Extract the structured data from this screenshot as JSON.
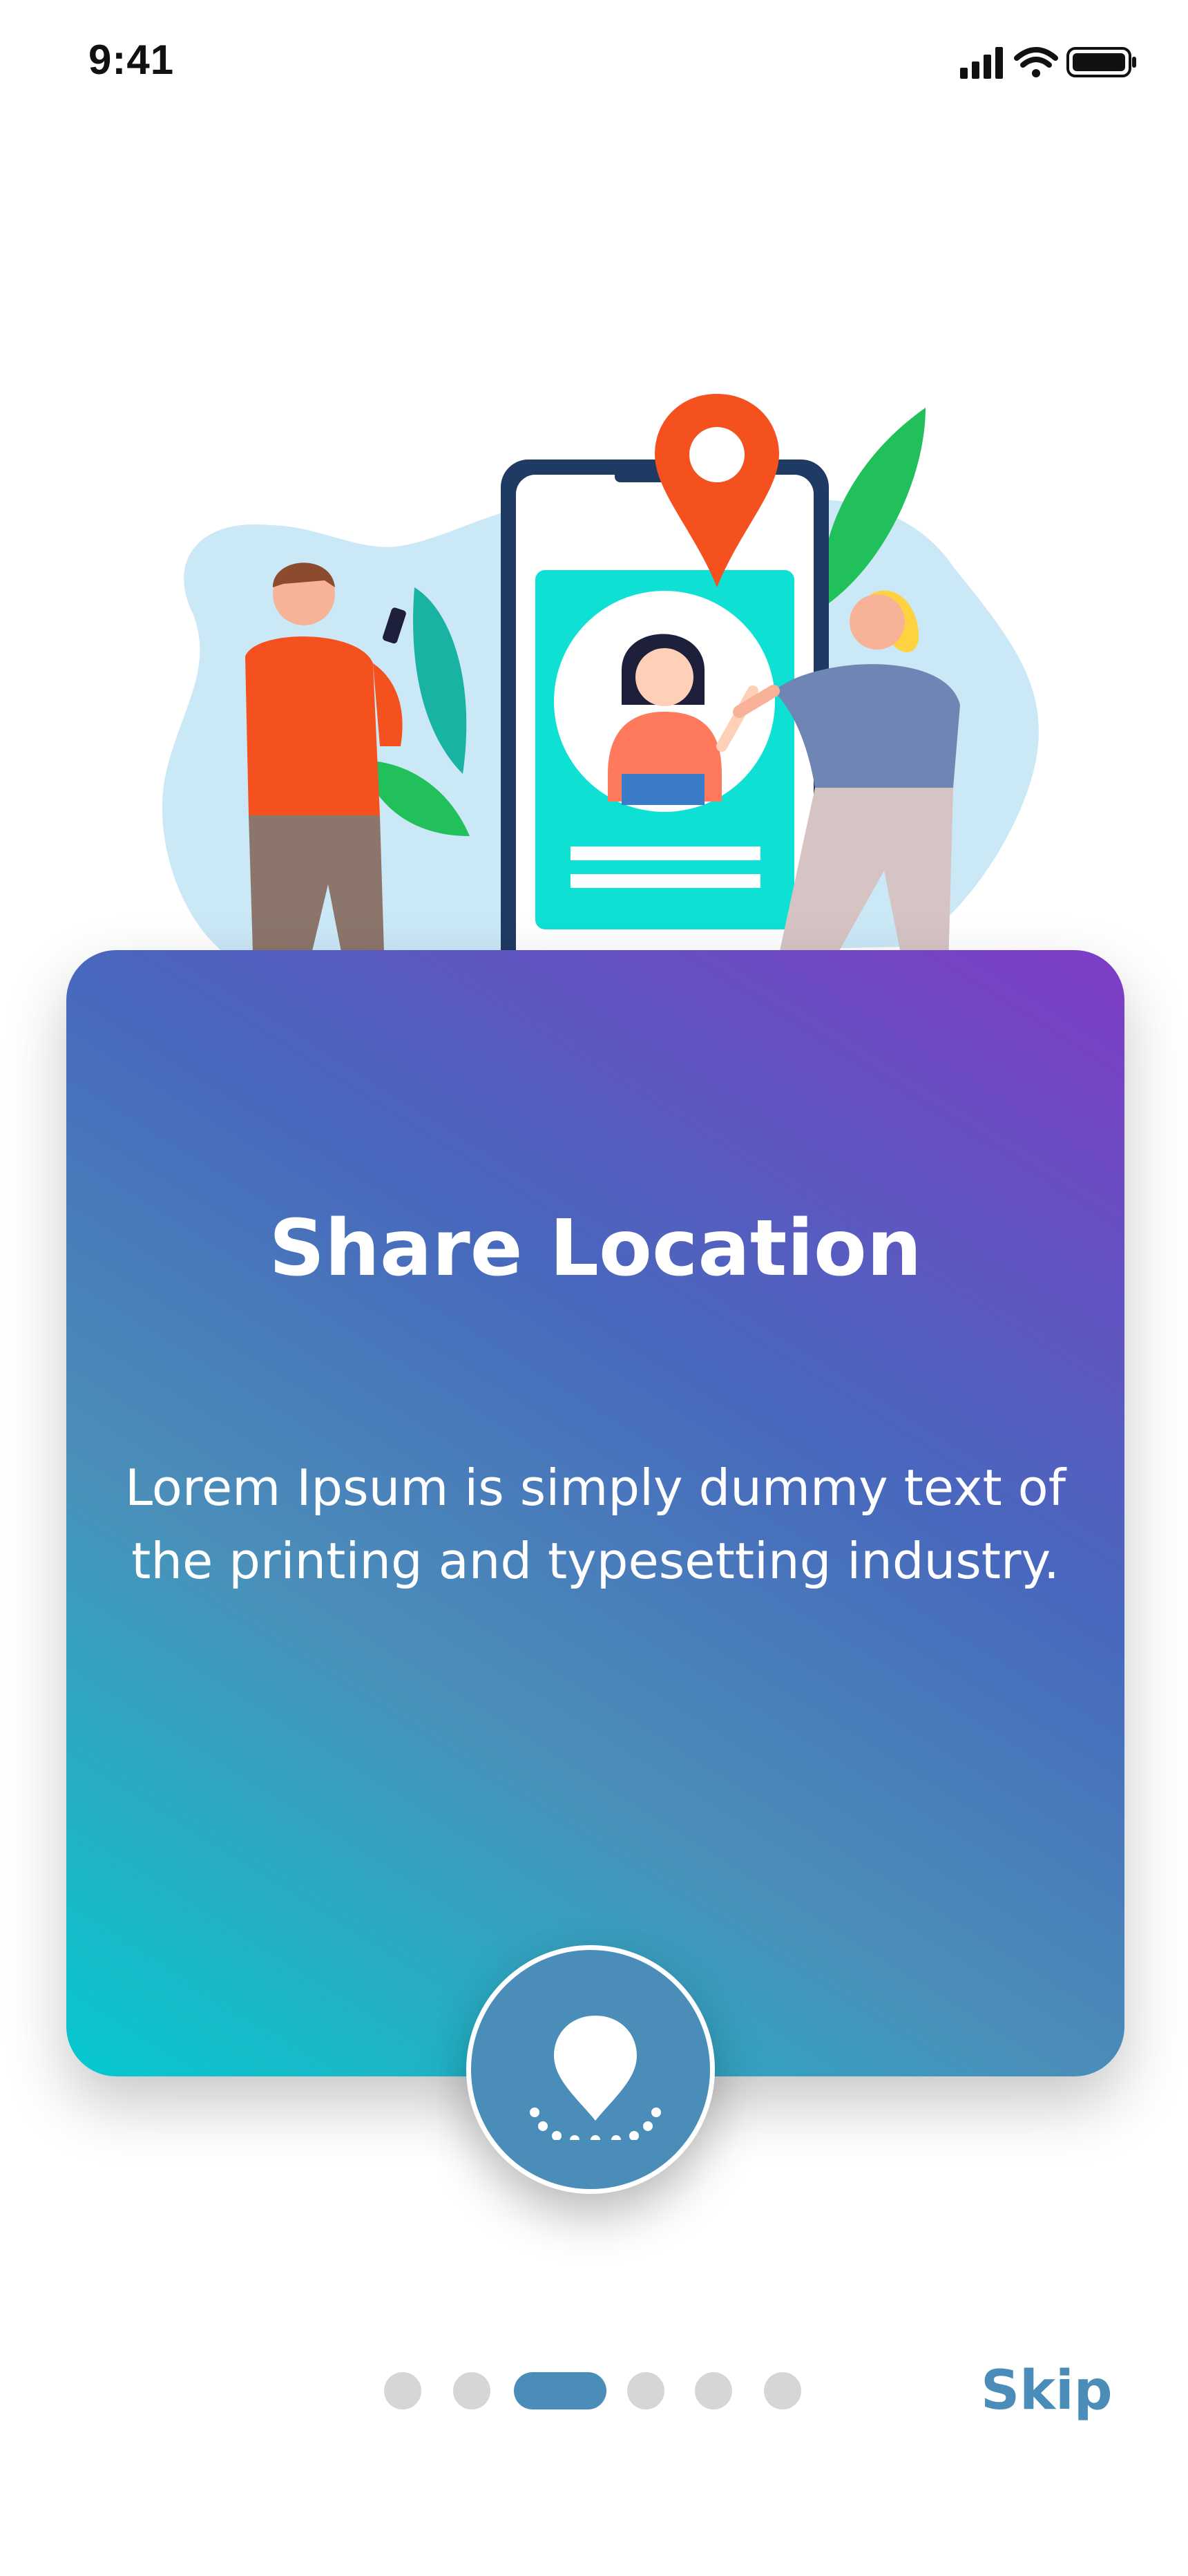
{
  "status_bar": {
    "time": "9:41",
    "icons": [
      "signal-icon",
      "wifi-icon",
      "battery-icon"
    ]
  },
  "slide": {
    "title": "Share Location",
    "description": "Lorem Ipsum is simply dummy text of the printing and typesetting industry.",
    "action_icon": "location-pin-icon"
  },
  "pager": {
    "count": 6,
    "active_index": 2
  },
  "skip_label": "Skip",
  "colors": {
    "accent": "#4a8db9",
    "gradient_start": "#05c9cf",
    "gradient_end": "#7f3cc7",
    "dot_inactive": "#d6d6d6",
    "pin": "#f4511e"
  }
}
